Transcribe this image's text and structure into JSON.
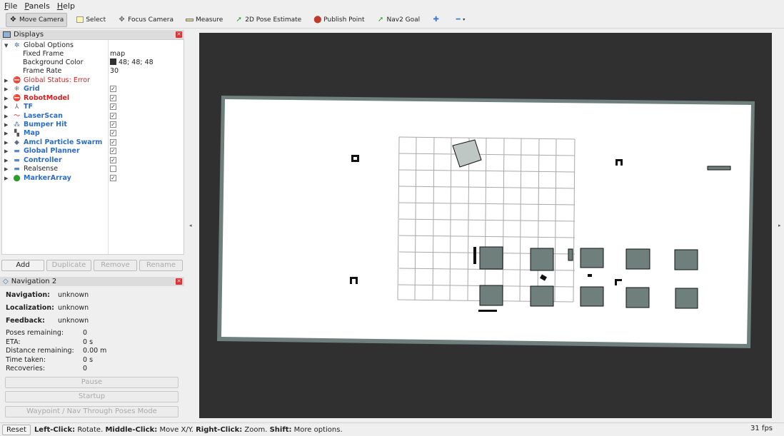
{
  "menu": [
    "File",
    "Panels",
    "Help"
  ],
  "toolbar": {
    "tools": [
      {
        "label": "Move Camera",
        "icon": "move-camera-icon",
        "active": true
      },
      {
        "label": "Select",
        "icon": "select-icon"
      },
      {
        "label": "Focus Camera",
        "icon": "focus-camera-icon"
      },
      {
        "label": "Measure",
        "icon": "measure-icon"
      },
      {
        "label": "2D Pose Estimate",
        "icon": "green-arrow-icon"
      },
      {
        "label": "Publish Point",
        "icon": "map-pin-icon"
      },
      {
        "label": "Nav2 Goal",
        "icon": "green-arrow-icon"
      }
    ],
    "extra_icons": [
      "plus-icon",
      "minus-icon"
    ]
  },
  "displays": {
    "title": "Displays",
    "global_options": {
      "label": "Global Options",
      "fixed_frame": {
        "name": "Fixed Frame",
        "value": "map"
      },
      "background_color": {
        "name": "Background Color",
        "value": "48; 48; 48"
      },
      "frame_rate": {
        "name": "Frame Rate",
        "value": "30"
      }
    },
    "global_status": "Global Status: Error",
    "items": [
      {
        "name": "Grid",
        "checked": true,
        "style": "blue",
        "icon": "grid-icon"
      },
      {
        "name": "RobotModel",
        "checked": true,
        "style": "error",
        "icon": "robot-model-icon"
      },
      {
        "name": "TF",
        "checked": true,
        "style": "blue",
        "icon": "tf-icon"
      },
      {
        "name": "LaserScan",
        "checked": true,
        "style": "blue",
        "icon": "laser-scan-icon"
      },
      {
        "name": "Bumper Hit",
        "checked": true,
        "style": "blue",
        "icon": "bumper-icon"
      },
      {
        "name": "Map",
        "checked": true,
        "style": "blue",
        "icon": "map-icon"
      },
      {
        "name": "Amcl Particle Swarm",
        "checked": true,
        "style": "blue",
        "icon": "particle-swarm-icon"
      },
      {
        "name": "Global Planner",
        "checked": true,
        "style": "blue",
        "icon": "folder-icon"
      },
      {
        "name": "Controller",
        "checked": true,
        "style": "blue",
        "icon": "folder-icon"
      },
      {
        "name": "Realsense",
        "checked": false,
        "style": "plain",
        "icon": "folder-icon"
      },
      {
        "name": "MarkerArray",
        "checked": true,
        "style": "blue",
        "icon": "marker-array-icon"
      }
    ],
    "buttons": {
      "add": "Add",
      "duplicate": "Duplicate",
      "remove": "Remove",
      "rename": "Rename"
    }
  },
  "navigation": {
    "title": "Navigation 2",
    "status": [
      {
        "label": "Navigation:",
        "value": "unknown"
      },
      {
        "label": "Localization:",
        "value": "unknown"
      },
      {
        "label": "Feedback:",
        "value": "unknown"
      }
    ],
    "stats": [
      {
        "label": "Poses remaining:",
        "value": "0"
      },
      {
        "label": "ETA:",
        "value": "0 s"
      },
      {
        "label": "Distance remaining:",
        "value": "0.00 m"
      },
      {
        "label": "Time taken:",
        "value": "0 s"
      },
      {
        "label": "Recoveries:",
        "value": "0"
      }
    ],
    "buttons": {
      "pause": "Pause",
      "startup": "Startup",
      "waypoint": "Waypoint / Nav Through Poses Mode"
    }
  },
  "statusbar": {
    "reset": "Reset",
    "hint_parts": [
      {
        "bold": true,
        "text": "Left-Click:"
      },
      {
        "bold": false,
        "text": " Rotate. "
      },
      {
        "bold": true,
        "text": "Middle-Click:"
      },
      {
        "bold": false,
        "text": " Move X/Y. "
      },
      {
        "bold": true,
        "text": "Right-Click:"
      },
      {
        "bold": false,
        "text": " Zoom. "
      },
      {
        "bold": true,
        "text": "Shift:"
      },
      {
        "bold": false,
        "text": " More options."
      }
    ],
    "fps": "31 fps"
  },
  "colors": {
    "viewport_bg": "#303030",
    "map_free": "#ffffff",
    "map_obstacle": "#6e7f7c",
    "grid": "#a0a0a0",
    "link_blue": "#2b6cc4",
    "error_red": "#cc2222"
  }
}
